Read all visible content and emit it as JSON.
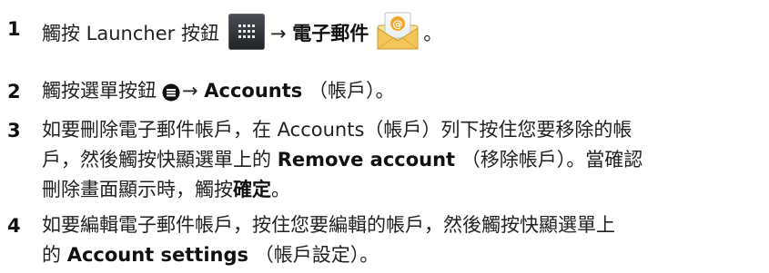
{
  "steps": [
    {
      "number": "1",
      "lines": [
        {
          "segments": [
            {
              "text": "觸按 Launcher 按鈕",
              "bold": false
            },
            {
              "icon": "launcher-icon"
            },
            {
              "text": "→ ",
              "bold": false
            },
            {
              "text": "電子郵件",
              "bold": true
            },
            {
              "icon": "email-icon"
            },
            {
              "text": "。",
              "bold": false
            }
          ]
        }
      ]
    },
    {
      "number": "2",
      "lines": [
        {
          "segments": [
            {
              "text": "觸按選單按鈕",
              "bold": false
            },
            {
              "icon": "menu-button-icon"
            },
            {
              "text": "→ ",
              "bold": false
            },
            {
              "text": "Accounts",
              "bold": true
            },
            {
              "text": " （帳戶）。",
              "bold": false
            }
          ]
        }
      ]
    },
    {
      "number": "3",
      "lines": [
        {
          "segments": [
            {
              "text": "如要刪除電子郵件帳戶，在 Accounts（帳戶）列下按住您要移除的帳",
              "bold": false
            }
          ]
        },
        {
          "segments": [
            {
              "text": "戶，然後觸按快顯選單上的 ",
              "bold": false
            },
            {
              "text": "Remove account",
              "bold": true
            },
            {
              "text": " （移除帳戶）。當確認",
              "bold": false
            }
          ]
        },
        {
          "segments": [
            {
              "text": "刪除畫面顯示時，觸按",
              "bold": false
            },
            {
              "text": "確定",
              "bold": true
            },
            {
              "text": "。",
              "bold": false
            }
          ]
        }
      ]
    },
    {
      "number": "4",
      "lines": [
        {
          "segments": [
            {
              "text": "如要編輯電子郵件帳戶，按住您要編輯的帳戶，然後觸按快顯選單上",
              "bold": false
            }
          ]
        },
        {
          "segments": [
            {
              "text": "的 ",
              "bold": false
            },
            {
              "text": "Account settings",
              "bold": true
            },
            {
              "text": " （帳戶設定）。",
              "bold": false
            }
          ]
        }
      ]
    }
  ]
}
